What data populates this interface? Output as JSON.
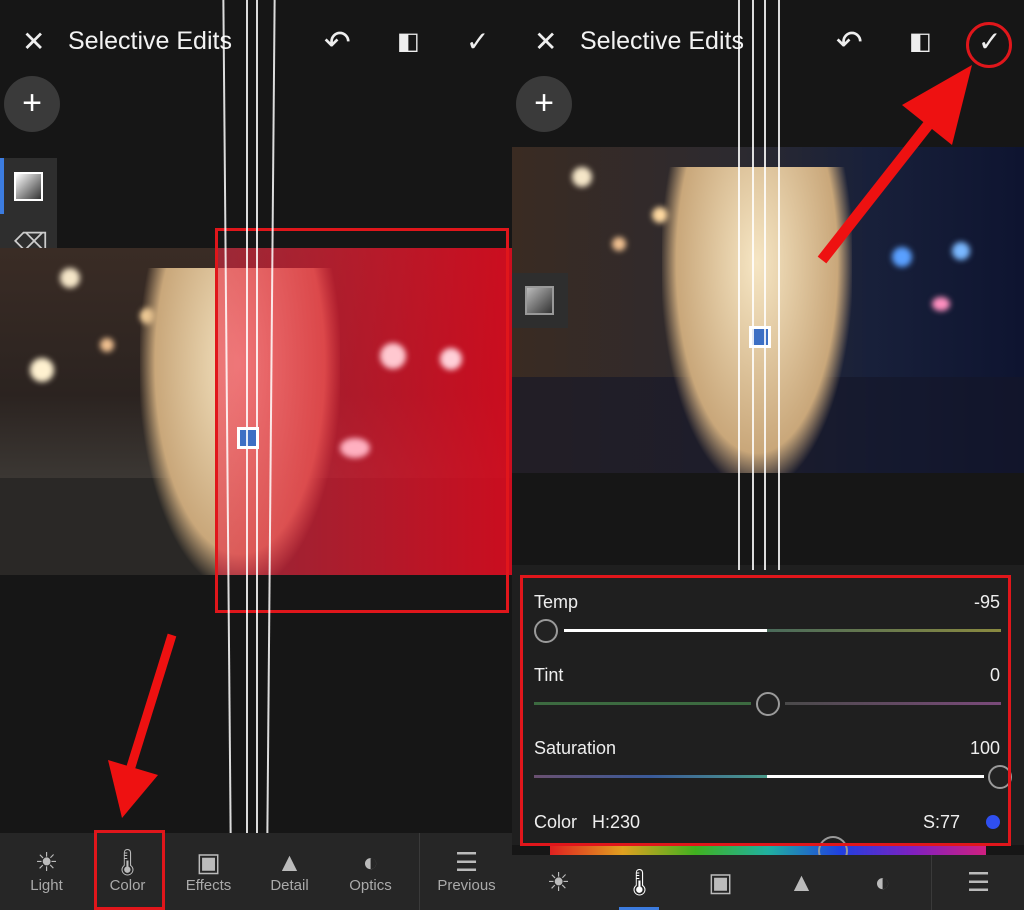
{
  "left": {
    "header": {
      "title": "Selective Edits",
      "close_icon": "close-icon",
      "undo_icon": "undo-icon",
      "compare_icon": "compare-icon",
      "confirm_icon": "check-icon"
    },
    "add_button": "+",
    "tools": [
      "linear-gradient-icon",
      "eraser-icon"
    ],
    "bottom_toolbar": [
      {
        "label": "Light",
        "icon": "sun-icon"
      },
      {
        "label": "Color",
        "icon": "thermometer-icon"
      },
      {
        "label": "Effects",
        "icon": "vignette-icon"
      },
      {
        "label": "Detail",
        "icon": "triangle-icon"
      },
      {
        "label": "Optics",
        "icon": "lens-icon"
      },
      {
        "label": "Previous",
        "icon": "previous-sliders-icon"
      }
    ]
  },
  "right": {
    "header": {
      "title": "Selective Edits"
    },
    "add_button": "+",
    "color_panel": {
      "sliders": [
        {
          "label": "Temp",
          "value": "-95",
          "min": -100,
          "max": 100,
          "num": -95
        },
        {
          "label": "Tint",
          "value": "0",
          "min": -100,
          "max": 100,
          "num": 0
        },
        {
          "label": "Saturation",
          "value": "100",
          "min": -100,
          "max": 100,
          "num": 100
        }
      ],
      "color": {
        "label": "Color",
        "hue": "H:230",
        "saturation": "S:77",
        "swatch": "#2f4ff0"
      }
    }
  },
  "colors": {
    "annotation": "#e0161b",
    "accent": "#3c6fc4",
    "background": "#161616"
  }
}
